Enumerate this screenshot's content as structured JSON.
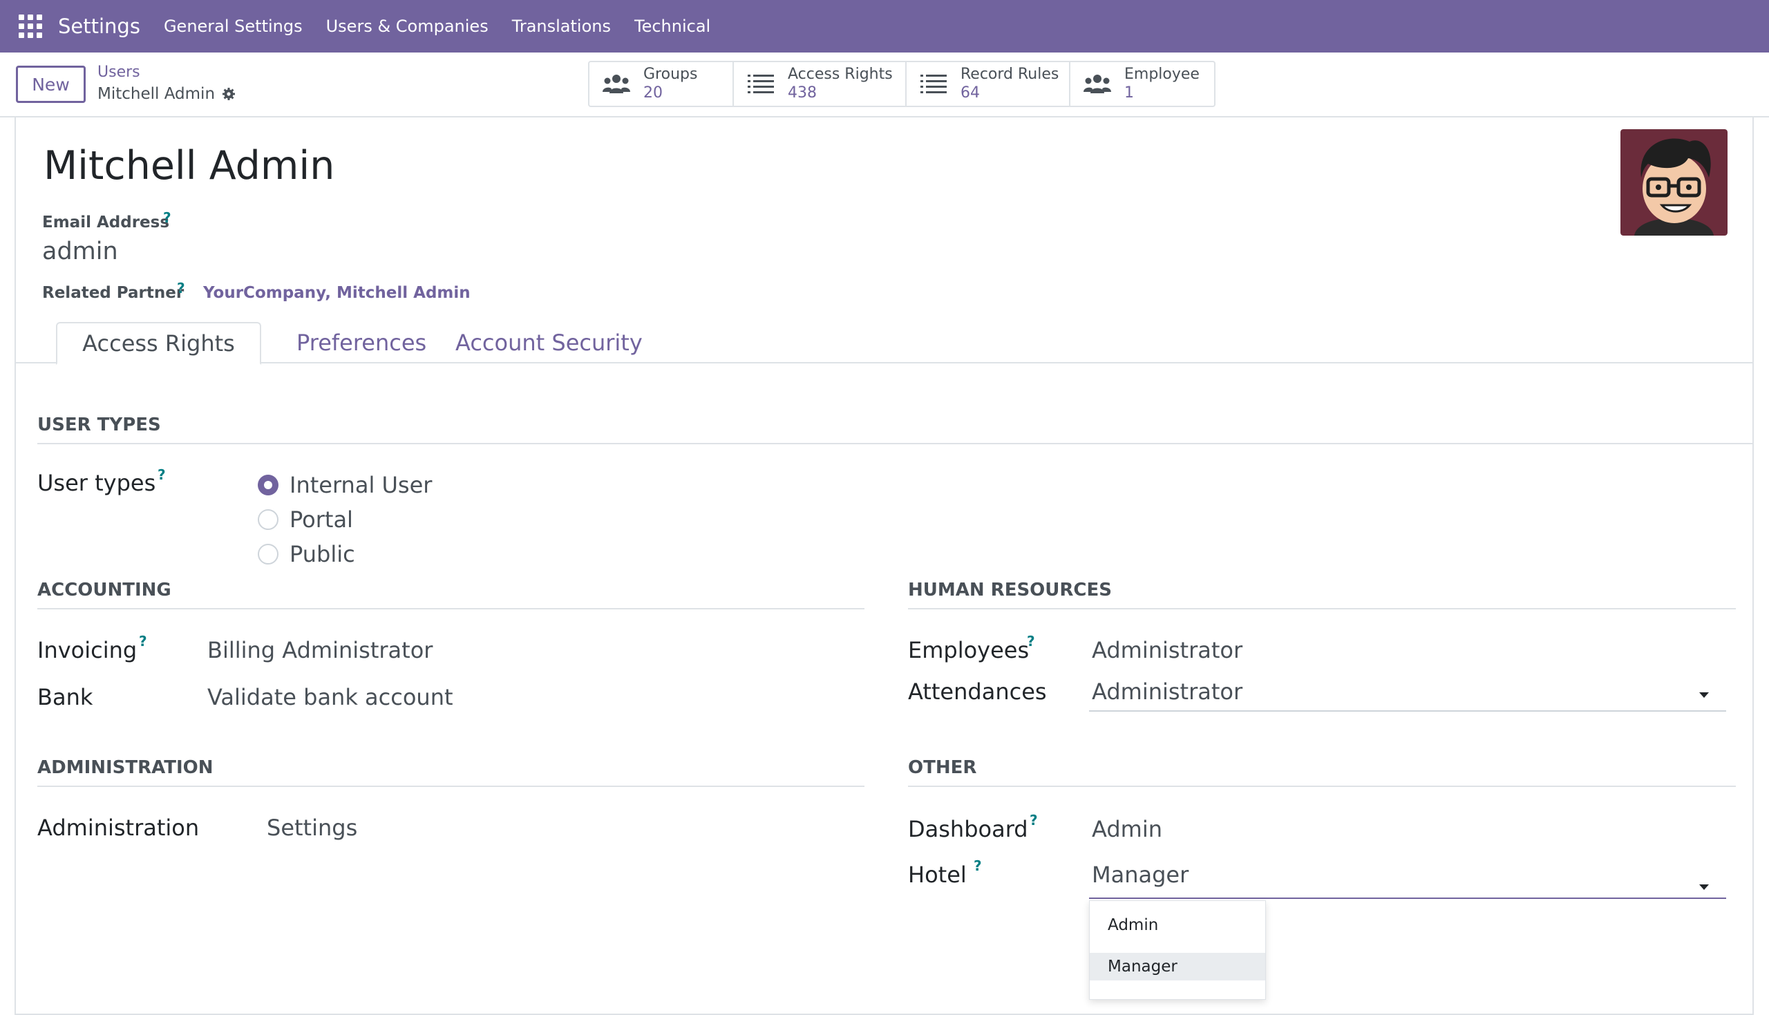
{
  "navbar": {
    "app_name": "Settings",
    "menu": [
      "General Settings",
      "Users & Companies",
      "Translations",
      "Technical"
    ]
  },
  "control_panel": {
    "new_label": "New",
    "breadcrumb_parent": "Users",
    "breadcrumb_current": "Mitchell Admin",
    "smart_buttons": [
      {
        "label": "Groups",
        "value": "20",
        "icon": "users-icon"
      },
      {
        "label": "Access Rights",
        "value": "438",
        "icon": "list-icon"
      },
      {
        "label": "Record Rules",
        "value": "64",
        "icon": "list-icon"
      },
      {
        "label": "Employee",
        "value": "1",
        "icon": "users-icon"
      }
    ]
  },
  "form": {
    "name": "Mitchell Admin",
    "email_label": "Email Address",
    "email_value": "admin",
    "partner_label": "Related Partner",
    "partner_value": "YourCompany, Mitchell Admin",
    "help_mark": "?"
  },
  "tabs": [
    "Access Rights",
    "Preferences",
    "Account Security"
  ],
  "user_types": {
    "section": "USER TYPES",
    "label": "User types",
    "options": [
      "Internal User",
      "Portal",
      "Public"
    ],
    "selected": "Internal User"
  },
  "accounting": {
    "section": "ACCOUNTING",
    "invoicing_label": "Invoicing",
    "invoicing_value": "Billing Administrator",
    "bank_label": "Bank",
    "bank_value": "Validate bank account"
  },
  "human_resources": {
    "section": "HUMAN RESOURCES",
    "employees_label": "Employees",
    "employees_value": "Administrator",
    "attendances_label": "Attendances",
    "attendances_value": "Administrator"
  },
  "administration": {
    "section": "ADMINISTRATION",
    "label": "Administration",
    "value": "Settings"
  },
  "other": {
    "section": "OTHER",
    "dashboard_label": "Dashboard",
    "dashboard_value": "Admin",
    "hotel_label": "Hotel",
    "hotel_value": "Manager",
    "hotel_options": [
      "Admin",
      "Manager"
    ],
    "hotel_highlighted": "Manager"
  },
  "colors": {
    "brand": "#71639e",
    "help": "#017e84"
  }
}
